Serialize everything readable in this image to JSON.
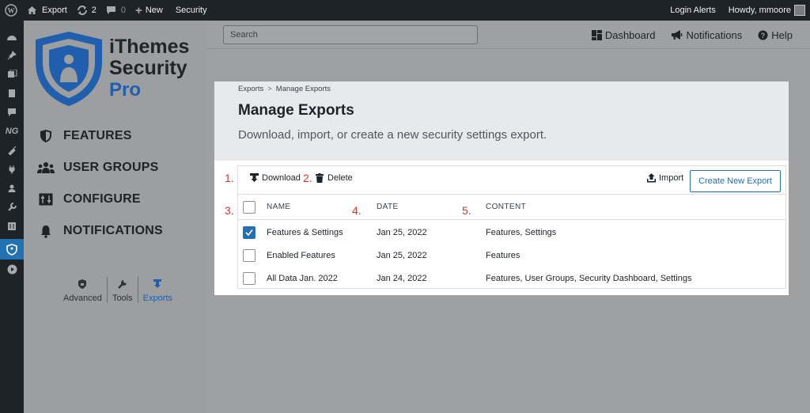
{
  "adminbar": {
    "site_name": "Export",
    "updates_count": "2",
    "comments_count": "0",
    "new_label": "New",
    "security_label": "Security",
    "login_alerts": "Login Alerts",
    "howdy": "Howdy, mmoore"
  },
  "logo": {
    "line1": "iThemes",
    "line2": "Security",
    "line3": "Pro"
  },
  "sidebar": {
    "items": [
      {
        "label": "FEATURES",
        "icon": "shield-icon"
      },
      {
        "label": "USER GROUPS",
        "icon": "users-icon"
      },
      {
        "label": "CONFIGURE",
        "icon": "configure-icon"
      },
      {
        "label": "NOTIFICATIONS",
        "icon": "bell-icon"
      }
    ],
    "tools": [
      {
        "label": "Advanced",
        "icon": "lock-icon"
      },
      {
        "label": "Tools",
        "icon": "wrench-icon"
      },
      {
        "label": "Exports",
        "icon": "download-icon",
        "active": true
      }
    ]
  },
  "topbar": {
    "search_placeholder": "Search",
    "dashboard": "Dashboard",
    "notifications": "Notifications",
    "help": "Help"
  },
  "breadcrumb": {
    "parent": "Exports",
    "separator": ">",
    "current": "Manage Exports"
  },
  "page": {
    "title": "Manage Exports",
    "description": "Download, import, or create a new security settings export."
  },
  "actions": {
    "download": "Download",
    "delete": "Delete",
    "import": "Import",
    "create": "Create New Export"
  },
  "table": {
    "headers": [
      "NAME",
      "DATE",
      "CONTENT"
    ],
    "rows": [
      {
        "name": "Features & Settings",
        "date": "Jan 25, 2022",
        "content": "Features, Settings",
        "checked": true
      },
      {
        "name": "Enabled Features",
        "date": "Jan 25, 2022",
        "content": "Features",
        "checked": false
      },
      {
        "name": "All Data Jan. 2022",
        "date": "Jan 24, 2022",
        "content": "Features, User Groups, Security Dashboard, Settings",
        "checked": false
      }
    ]
  },
  "annotations": [
    "1.",
    "2.",
    "3.",
    "4.",
    "5."
  ],
  "colors": {
    "accent": "#2271b1",
    "annotation": "#d63638",
    "adminbar": "#1d2327"
  }
}
